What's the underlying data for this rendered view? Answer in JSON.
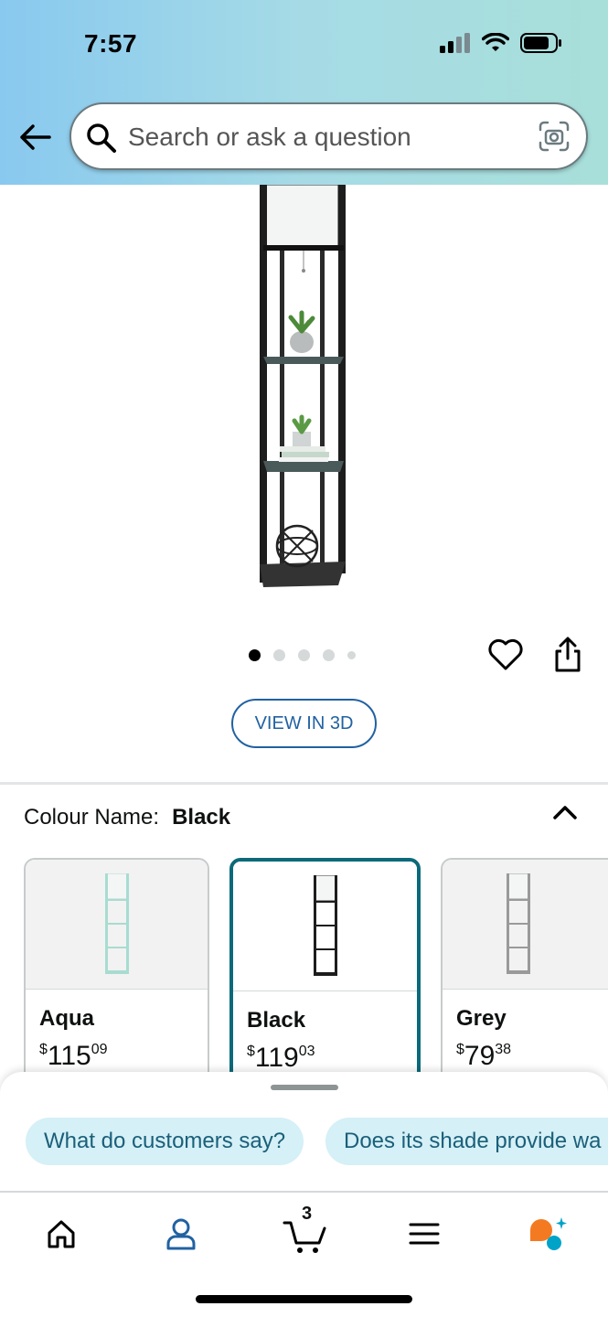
{
  "status_bar": {
    "time": "7:57"
  },
  "search": {
    "placeholder": "Search or ask a question"
  },
  "product": {
    "gallery": {
      "total_images": 5,
      "active_index": 0
    },
    "view_3d_label": "VIEW IN 3D"
  },
  "colour": {
    "label": "Colour Name:",
    "selected": "Black",
    "options": [
      {
        "name": "Aqua",
        "currency": "$",
        "price_dollars": "115",
        "price_cents": "09"
      },
      {
        "name": "Black",
        "currency": "$",
        "price_dollars": "119",
        "price_cents": "03",
        "selected": true
      },
      {
        "name": "Grey",
        "currency": "$",
        "price_dollars": "79",
        "price_cents": "38"
      }
    ]
  },
  "suggestions": {
    "chips": [
      "What do customers say?",
      "Does its shade provide wa"
    ]
  },
  "tabbar": {
    "cart_count": "3",
    "items": [
      "home-icon",
      "account-icon",
      "cart-icon",
      "menu-icon",
      "rufus-icon"
    ]
  },
  "colors": {
    "accent_teal": "#0b6a7a",
    "link_blue": "#2162a1",
    "chip_bg": "#d5f0f6",
    "rufus_orange": "#f47a21",
    "rufus_teal": "#00a3c8"
  }
}
